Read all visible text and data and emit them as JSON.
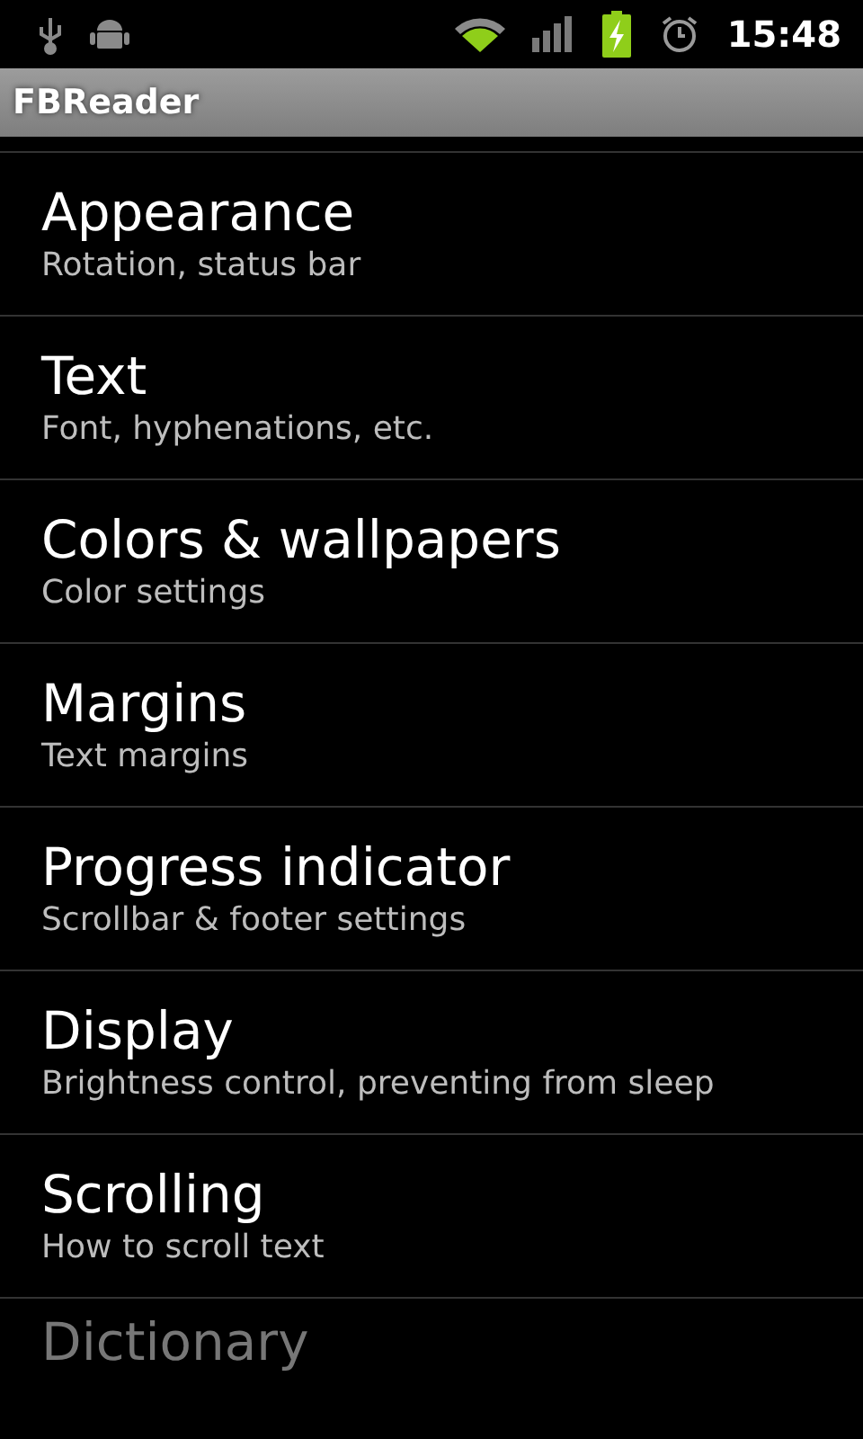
{
  "status_bar": {
    "time": "15:48"
  },
  "window": {
    "title": "FBReader"
  },
  "items": [
    {
      "title": "Appearance",
      "summary": "Rotation, status bar"
    },
    {
      "title": "Text",
      "summary": "Font, hyphenations, etc."
    },
    {
      "title": "Colors & wallpapers",
      "summary": "Color settings"
    },
    {
      "title": "Margins",
      "summary": "Text margins"
    },
    {
      "title": "Progress indicator",
      "summary": "Scrollbar & footer settings"
    },
    {
      "title": "Display",
      "summary": "Brightness control, preventing from sleep"
    },
    {
      "title": "Scrolling",
      "summary": "How to scroll text"
    },
    {
      "title": "Dictionary"
    }
  ]
}
